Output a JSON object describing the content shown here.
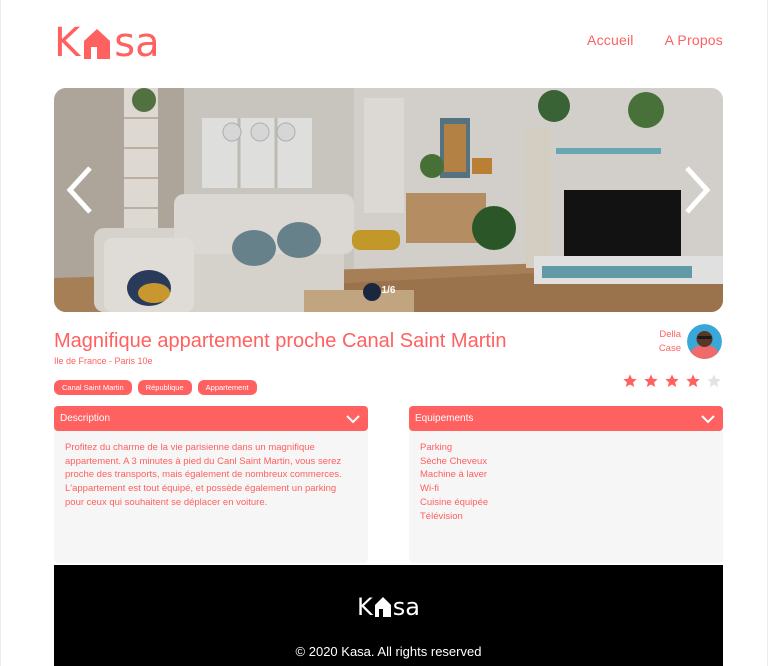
{
  "brand": {
    "name": "Kasa",
    "accent_color": "#FF6060",
    "logo_parts": [
      "K",
      "sa"
    ]
  },
  "nav": {
    "items": [
      {
        "label": "Accueil"
      },
      {
        "label": "A Propos"
      }
    ]
  },
  "carousel": {
    "counter": "1/6",
    "prev_icon": "chevron-left-icon",
    "next_icon": "chevron-right-icon"
  },
  "listing": {
    "title": "Magnifique appartement proche Canal Saint Martin",
    "location": "Ile de France - Paris 10e",
    "tags": [
      "Canal Saint Martin",
      "République",
      "Appartement"
    ],
    "host": {
      "first_name": "Della",
      "last_name": "Case"
    },
    "rating": 4,
    "rating_max": 5
  },
  "description": {
    "title": "Description",
    "text": "Profitez du charme de la vie parisienne dans un magnifique appartement. A 3 minutes à pied du Canl Saint Martin, vous serez proche des transports, mais également de nombreux commerces. L'appartement est tout équipé, et possède également un parking pour ceux qui souhaitent se déplacer en voiture."
  },
  "equipements": {
    "title": "Equipements",
    "items": [
      "Parking",
      "Sèche Cheveux",
      "Machine à laver",
      "Wi-fi",
      "Cuisine équipée",
      "Télévision"
    ]
  },
  "footer": {
    "copyright": "© 2020 Kasa. All rights reserved"
  }
}
